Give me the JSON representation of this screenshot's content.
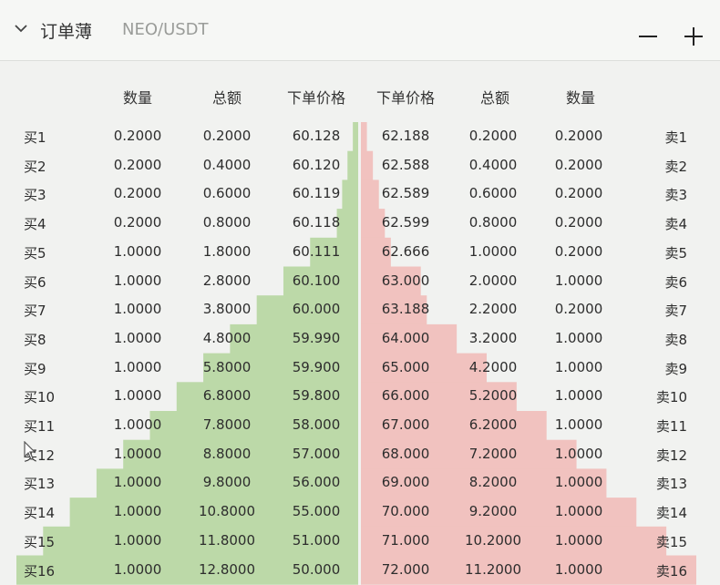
{
  "header": {
    "title": "订单薄",
    "pair": "NEO/USDT",
    "minus_label": "—",
    "plus_label": "+"
  },
  "columns": {
    "bid_qty": "数量",
    "bid_total": "总额",
    "bid_price": "下单价格",
    "ask_price": "下单价格",
    "ask_total": "总额",
    "ask_qty": "数量"
  },
  "colors": {
    "bid_depth": "#bcd9a8",
    "ask_depth": "#f1c2bf",
    "background": "#f1f2f0"
  },
  "rows": [
    {
      "bid_label": "买1",
      "bid_qty": "0.2000",
      "bid_total": "0.2000",
      "bid_price": "60.128",
      "ask_price": "62.188",
      "ask_total": "0.2000",
      "ask_qty": "0.2000",
      "ask_label": "卖1"
    },
    {
      "bid_label": "买2",
      "bid_qty": "0.2000",
      "bid_total": "0.4000",
      "bid_price": "60.120",
      "ask_price": "62.588",
      "ask_total": "0.4000",
      "ask_qty": "0.2000",
      "ask_label": "卖2"
    },
    {
      "bid_label": "买3",
      "bid_qty": "0.2000",
      "bid_total": "0.6000",
      "bid_price": "60.119",
      "ask_price": "62.589",
      "ask_total": "0.6000",
      "ask_qty": "0.2000",
      "ask_label": "卖3"
    },
    {
      "bid_label": "买4",
      "bid_qty": "0.2000",
      "bid_total": "0.8000",
      "bid_price": "60.118",
      "ask_price": "62.599",
      "ask_total": "0.8000",
      "ask_qty": "0.2000",
      "ask_label": "卖4"
    },
    {
      "bid_label": "买5",
      "bid_qty": "1.0000",
      "bid_total": "1.8000",
      "bid_price": "60.111",
      "ask_price": "62.666",
      "ask_total": "1.0000",
      "ask_qty": "0.2000",
      "ask_label": "卖5"
    },
    {
      "bid_label": "买6",
      "bid_qty": "1.0000",
      "bid_total": "2.8000",
      "bid_price": "60.100",
      "ask_price": "63.000",
      "ask_total": "2.0000",
      "ask_qty": "1.0000",
      "ask_label": "卖6"
    },
    {
      "bid_label": "买7",
      "bid_qty": "1.0000",
      "bid_total": "3.8000",
      "bid_price": "60.000",
      "ask_price": "63.188",
      "ask_total": "2.2000",
      "ask_qty": "0.2000",
      "ask_label": "卖7"
    },
    {
      "bid_label": "买8",
      "bid_qty": "1.0000",
      "bid_total": "4.8000",
      "bid_price": "59.990",
      "ask_price": "64.000",
      "ask_total": "3.2000",
      "ask_qty": "1.0000",
      "ask_label": "卖8"
    },
    {
      "bid_label": "买9",
      "bid_qty": "1.0000",
      "bid_total": "5.8000",
      "bid_price": "59.900",
      "ask_price": "65.000",
      "ask_total": "4.2000",
      "ask_qty": "1.0000",
      "ask_label": "卖9"
    },
    {
      "bid_label": "买10",
      "bid_qty": "1.0000",
      "bid_total": "6.8000",
      "bid_price": "59.800",
      "ask_price": "66.000",
      "ask_total": "5.2000",
      "ask_qty": "1.0000",
      "ask_label": "卖10"
    },
    {
      "bid_label": "买11",
      "bid_qty": "1.0000",
      "bid_total": "7.8000",
      "bid_price": "58.000",
      "ask_price": "67.000",
      "ask_total": "6.2000",
      "ask_qty": "1.0000",
      "ask_label": "卖11"
    },
    {
      "bid_label": "买12",
      "bid_qty": "1.0000",
      "bid_total": "8.8000",
      "bid_price": "57.000",
      "ask_price": "68.000",
      "ask_total": "7.2000",
      "ask_qty": "1.0000",
      "ask_label": "卖12"
    },
    {
      "bid_label": "买13",
      "bid_qty": "1.0000",
      "bid_total": "9.8000",
      "bid_price": "56.000",
      "ask_price": "69.000",
      "ask_total": "8.2000",
      "ask_qty": "1.0000",
      "ask_label": "卖13"
    },
    {
      "bid_label": "买14",
      "bid_qty": "1.0000",
      "bid_total": "10.8000",
      "bid_price": "55.000",
      "ask_price": "70.000",
      "ask_total": "9.2000",
      "ask_qty": "1.0000",
      "ask_label": "卖14"
    },
    {
      "bid_label": "买15",
      "bid_qty": "1.0000",
      "bid_total": "11.8000",
      "bid_price": "51.000",
      "ask_price": "71.000",
      "ask_total": "10.2000",
      "ask_qty": "1.0000",
      "ask_label": "卖15"
    },
    {
      "bid_label": "买16",
      "bid_qty": "1.0000",
      "bid_total": "12.8000",
      "bid_price": "50.000",
      "ask_price": "72.000",
      "ask_total": "11.2000",
      "ask_qty": "1.0000",
      "ask_label": "卖16"
    }
  ]
}
